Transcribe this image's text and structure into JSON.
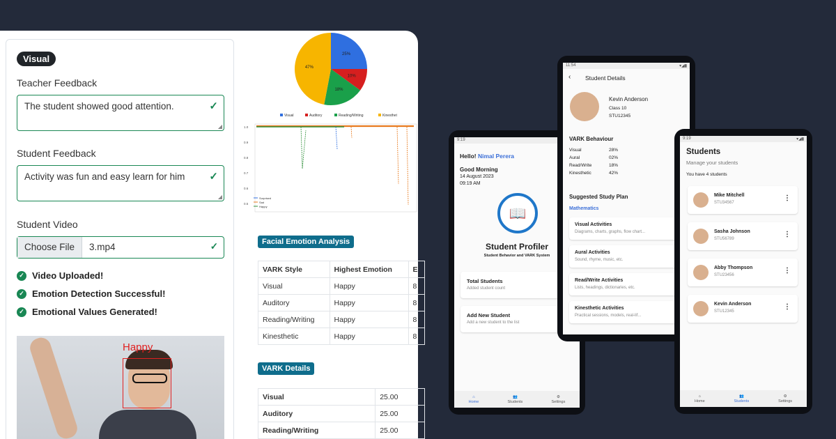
{
  "web": {
    "style_pill": "Visual",
    "teacher_feedback_label": "Teacher Feedback",
    "teacher_feedback_value": "The student showed good attention.",
    "student_feedback_label": "Student Feedback",
    "student_feedback_value": "Activity was fun and easy learn for him",
    "student_video_label": "Student Video",
    "choose_file_label": "Choose File",
    "file_name": "3.mp4",
    "statuses": [
      "Video Uploaded!",
      "Emotion Detection Successful!",
      "Emotional Values Generated!"
    ],
    "detected_emotion": "Happy",
    "facial_tag": "Facial Emotion Analysis",
    "facial_table": {
      "headers": [
        "VARK Style",
        "Highest Emotion",
        "E"
      ],
      "rows": [
        [
          "Visual",
          "Happy",
          "8"
        ],
        [
          "Auditory",
          "Happy",
          "8"
        ],
        [
          "Reading/Writing",
          "Happy",
          "8"
        ],
        [
          "Kinesthetic",
          "Happy",
          "8"
        ]
      ]
    },
    "vark_tag": "VARK Details",
    "vark_table": {
      "rows": [
        [
          "Visual",
          "25.00"
        ],
        [
          "Auditory",
          "25.00"
        ],
        [
          "Reading/Writing",
          "25.00"
        ]
      ]
    }
  },
  "chart_data": [
    {
      "type": "pie",
      "categories": [
        "Visual",
        "Auditory",
        "Reading/Writing",
        "Kinesthetic"
      ],
      "values": [
        25,
        10,
        18,
        47
      ],
      "labels": [
        "25%",
        "10%",
        "18%",
        "47%"
      ],
      "colors": [
        "#2f6fe0",
        "#d61f1f",
        "#1aa04a",
        "#f7b500"
      ],
      "legend": "bottom"
    },
    {
      "type": "line",
      "series": [
        {
          "name": "Surprised"
        },
        {
          "name": "Sad"
        },
        {
          "name": "Happy"
        }
      ],
      "ytick_labels": [
        "1.0",
        "0.9",
        "0.8",
        "0.7",
        "0.6",
        "0.5"
      ],
      "legend": "bottom-left"
    }
  ],
  "phone1": {
    "time": "9:19",
    "greeting": "Hello!",
    "user": "Nimal Perera",
    "salutation": "Good Morning",
    "date": "14 August 2023",
    "clock": "09:19 AM",
    "app_title": "Student Profiler",
    "app_subtitle": "Student Behavior and VARK System",
    "tiles": [
      {
        "title": "Total Students",
        "sub": "Added student count"
      },
      {
        "title": "Add New Student",
        "sub": "Add a new student to the list"
      }
    ],
    "nav": [
      "Home",
      "Students",
      "Settings"
    ]
  },
  "phone2": {
    "time": "11:54",
    "header": "Student Details",
    "name": "Kevin Anderson",
    "class": "Class 10",
    "id": "STU12345",
    "vark_title": "VARK Behaviour",
    "vark": [
      [
        "Visual",
        "28%"
      ],
      [
        "Aural",
        "02%"
      ],
      [
        "Read/Write",
        "18%"
      ],
      [
        "Kinesthetic",
        "42%"
      ]
    ],
    "plan_title": "Suggested Study Plan",
    "subject": "Mathematics",
    "activities": [
      {
        "title": "Visual Activities",
        "sub": "Diagrams, charts, graphs, flow chart..."
      },
      {
        "title": "Aural Activities",
        "sub": "Sound, rhyme, music, etc."
      },
      {
        "title": "Read/Write Activities",
        "sub": "Lists, headings, dictionaries, etc."
      },
      {
        "title": "Kinesthetic Activities",
        "sub": "Practical sessions, models, real-lif..."
      }
    ]
  },
  "phone3": {
    "time": "9:19",
    "title": "Students",
    "subtitle": "Manage your students",
    "count_text": "You have 4 students",
    "students": [
      {
        "name": "Mike Mitchell",
        "id": "STU34567"
      },
      {
        "name": "Sasha Johnson",
        "id": "STU56789"
      },
      {
        "name": "Abby Thompson",
        "id": "STU23456"
      },
      {
        "name": "Kevin Anderson",
        "id": "STU12345"
      }
    ],
    "nav": [
      "Home",
      "Students",
      "Settings"
    ]
  }
}
